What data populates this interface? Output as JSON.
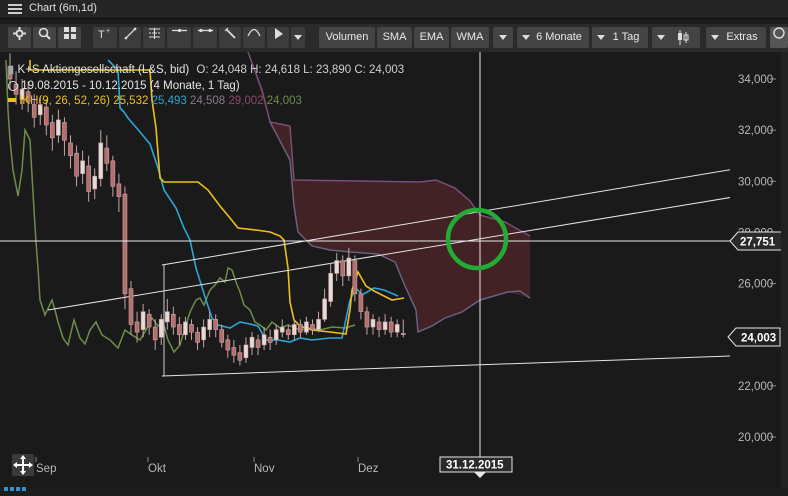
{
  "window": {
    "title": "Chart (6m,1d)"
  },
  "toolbar": {
    "volumen": "Volumen",
    "sma": "SMA",
    "ema": "EMA",
    "wma": "WMA",
    "period": "6 Monate",
    "interval": "1 Tag",
    "extras": "Extras"
  },
  "legend": {
    "name": "K+S Aktiengesellschaft (L&S, bid)",
    "ohlc": "O: 24,048  H: 24,618  L: 23,890  C: 24,003",
    "range": "19.08.2015 - 10.12.2015 (4 Monate, 1 Tag)",
    "ikh_label": "IKH(9, 26, 52, 26)",
    "ikh_v1": "25,532",
    "ikh_v2": "25,493",
    "ikh_v3": "24,508",
    "ikh_v4": "29,002",
    "ikh_v5": "24,003"
  },
  "colors": {
    "candle": "#c9a9a6",
    "tenkan": "#2aa8d8",
    "kijun": "#f0c020",
    "chikou": "#6f8e4d",
    "span_a": "#7a4a74",
    "span_b": "#5e5676",
    "cloud": "#5a2a2e",
    "circle": "#22aa33"
  },
  "axis": {
    "y_ticks": [
      "34,000",
      "32,000",
      "30,000",
      "28,000",
      "26,000",
      "24,000",
      "22,000",
      "20,000"
    ],
    "x_ticks": [
      "Sep",
      "Okt",
      "Nov",
      "Dez"
    ],
    "crosshair_price": "27,751",
    "last_price": "24,003",
    "crosshair_date": "31.12.2015"
  },
  "chart_data": {
    "type": "candlestick",
    "y_range": [
      19.5,
      35
    ],
    "note_visible": "Ichimoku cloud indicator with trendlines",
    "crosshair": {
      "date": "31.12.2015",
      "price": 27.751
    },
    "last": 24.003
  }
}
